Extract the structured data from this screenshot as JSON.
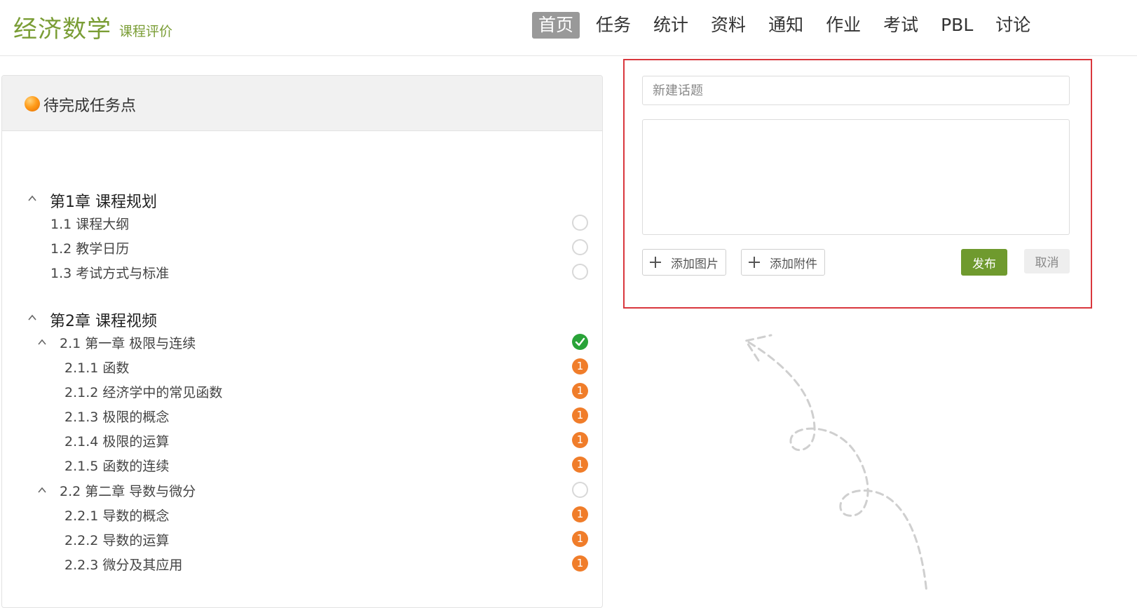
{
  "header": {
    "course_title": "经济数学",
    "course_eval": "课程评价",
    "nav": [
      {
        "label": "首页",
        "active": true
      },
      {
        "label": "任务"
      },
      {
        "label": "统计"
      },
      {
        "label": "资料"
      },
      {
        "label": "通知"
      },
      {
        "label": "作业"
      },
      {
        "label": "考试"
      },
      {
        "label": "PBL"
      },
      {
        "label": "讨论"
      }
    ]
  },
  "tasks": {
    "title": "待完成任务点",
    "tree": [
      {
        "label": "第1章 课程规划",
        "level": "chapter"
      },
      {
        "label": "1.1   课程大纲",
        "level": "section",
        "status": "empty"
      },
      {
        "label": "1.2   教学日历",
        "level": "section",
        "status": "empty"
      },
      {
        "label": "1.3   考试方式与标准",
        "level": "section",
        "status": "empty"
      },
      {
        "label": "第2章 课程视频",
        "level": "chapter"
      },
      {
        "label": "2.1   第一章 极限与连续",
        "level": "subchapter",
        "status": "done"
      },
      {
        "label": "2.1.1 函数",
        "level": "sub",
        "status": "pending",
        "count": "1"
      },
      {
        "label": "2.1.2 经济学中的常见函数",
        "level": "sub",
        "status": "pending",
        "count": "1"
      },
      {
        "label": "2.1.3 极限的概念",
        "level": "sub",
        "status": "pending",
        "count": "1"
      },
      {
        "label": "2.1.4 极限的运算",
        "level": "sub",
        "status": "pending",
        "count": "1"
      },
      {
        "label": "2.1.5 函数的连续",
        "level": "sub",
        "status": "pending",
        "count": "1"
      },
      {
        "label": "2.2   第二章 导数与微分",
        "level": "subchapter",
        "status": "empty"
      },
      {
        "label": "2.2.1 导数的概念",
        "level": "sub",
        "status": "pending",
        "count": "1"
      },
      {
        "label": "2.2.2 导数的运算",
        "level": "sub",
        "status": "pending",
        "count": "1"
      },
      {
        "label": "2.2.3 微分及其应用",
        "level": "sub",
        "status": "pending",
        "count": "1"
      }
    ]
  },
  "editor": {
    "topic_placeholder": "新建话题",
    "add_image": "添加图片",
    "add_attachment": "添加附件",
    "publish": "发布",
    "cancel": "取消"
  },
  "colors": {
    "brand": "#7a9d35",
    "publish": "#6f9a2e",
    "highlight_border": "#d9373d",
    "done": "#29a338",
    "pending": "#f07d2a"
  }
}
